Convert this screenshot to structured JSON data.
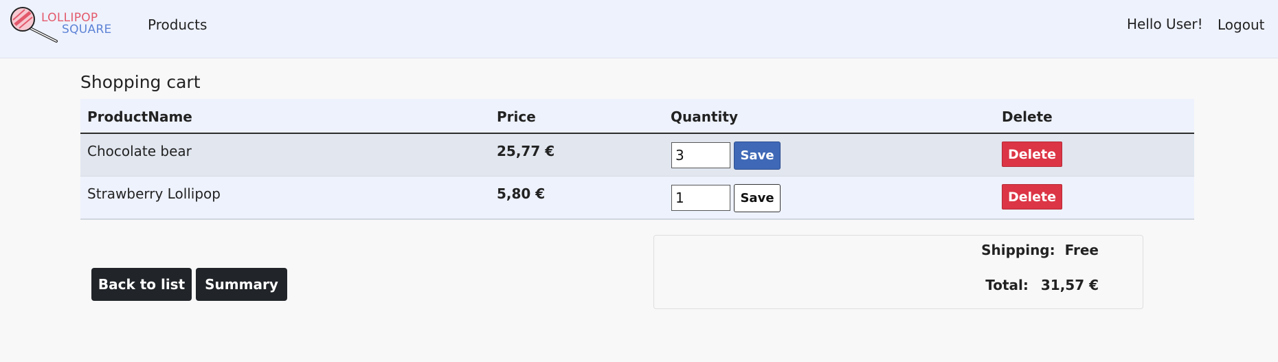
{
  "brand": {
    "line1": "LOLLIPOP",
    "line2": "SQUARE"
  },
  "nav": {
    "products": "Products",
    "greeting": "Hello User!",
    "logout": "Logout"
  },
  "page": {
    "title": "Shopping cart"
  },
  "table": {
    "headers": [
      "ProductName",
      "Price",
      "Quantity",
      "Delete"
    ],
    "rows": [
      {
        "name": "Chocolate bear",
        "price": "25,77 €",
        "quantity": "3",
        "save": "Save",
        "delete": "Delete"
      },
      {
        "name": "Strawberry Lollipop",
        "price": "5,80 €",
        "quantity": "1",
        "save": "Save",
        "delete": "Delete"
      }
    ]
  },
  "actions": {
    "back": "Back to list",
    "summary": "Summary"
  },
  "totals": {
    "shipping_label": "Shipping:",
    "shipping_value": "Free",
    "total_label": "Total:",
    "total_value": "31,57 €"
  },
  "colors": {
    "navbar": "#eef2fd",
    "primary": "#3f69b7",
    "danger": "#dc3545",
    "dark": "#212529"
  }
}
